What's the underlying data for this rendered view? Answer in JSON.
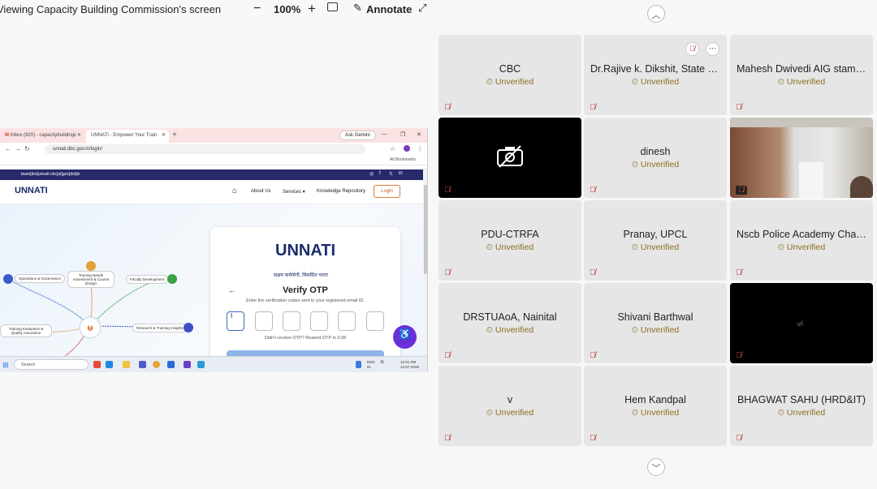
{
  "share_bar": {
    "title": "Viewing Capacity Building Commission's screen",
    "zoom_out": "−",
    "zoom": "100%",
    "zoom_in": "+",
    "annotate_icon": "pencil-icon",
    "annotate": "Annotate"
  },
  "shared_screen": {
    "tabs": [
      {
        "label": "Inbox (920) - capacitybuildingc"
      },
      {
        "label": "UNNATI - Empower Your Train"
      }
    ],
    "ask_gemini": "Ask Gemini",
    "url": "unnati.dbc.gov.in/login/",
    "bookmarks_label": "All Bookmarks",
    "site": {
      "email": "team[dot]unnati-cbc[at]gov[dot]in",
      "logo": "UNNATI",
      "nav": [
        "About Us",
        "Services ▾",
        "Knowledge Repository"
      ],
      "login": "Login",
      "nodes": [
        "Operations & Governance",
        "Training Needs Assessment & Course Design",
        "Faculty Development",
        "Training Evaluation & Quality Assurance",
        "Research & Training Insights"
      ],
      "otp": {
        "logo": "UNNATI",
        "tagline": "सक्षम कर्मयोगी, विकसित भारत",
        "title": "Verify OTP",
        "description": "Enter the verification codes sent to your registered email ID.",
        "cursor": "I",
        "resend": "Didn't receive OTP? Resend OTP  in 0:38"
      }
    },
    "taskbar": {
      "search": "Search",
      "lang": "ENG",
      "region": "IN",
      "time": "12:21 PM",
      "date": "13-07-2026"
    }
  },
  "participants": [
    {
      "name": "CBC",
      "status": "Unverified",
      "video": "off"
    },
    {
      "name": "Dr.Rajive k. Dikshit, State N...",
      "status": "Unverified",
      "video": "off",
      "hover_controls": true
    },
    {
      "name": "Mahesh Dwivedi AIG stamp...",
      "status": "Unverified",
      "video": "off"
    },
    {
      "name": "",
      "status": "",
      "video": "camera-disabled"
    },
    {
      "name": "dinesh",
      "status": "Unverified",
      "video": "off"
    },
    {
      "name": "",
      "status": "",
      "video": "on"
    },
    {
      "name": "PDU-CTRFA",
      "status": "Unverified",
      "video": "off"
    },
    {
      "name": "Pranay, UPCL",
      "status": "Unverified",
      "video": "off"
    },
    {
      "name": "Nscb Police Academy Chan...",
      "status": "Unverified",
      "video": "off"
    },
    {
      "name": "DRSTUAoA, Nainital",
      "status": "Unverified",
      "video": "off"
    },
    {
      "name": "Shivani Barthwal",
      "status": "Unverified",
      "video": "off"
    },
    {
      "name": "",
      "status": "",
      "video": "dark"
    },
    {
      "name": "v",
      "status": "Unverified",
      "video": "off"
    },
    {
      "name": "Hem Kandpal",
      "status": "Unverified",
      "video": "off"
    },
    {
      "name": "BHAGWAT SAHU (HRD&IT)",
      "status": "Unverified",
      "video": "off"
    }
  ],
  "icons": {
    "status": "clock-icon",
    "mic": "mic-off-icon",
    "page_up": "chevron-up-icon",
    "page_down": "chevron-down-icon"
  },
  "colors": {
    "status": "#8b6d1e",
    "mic_off": "#b31d1d",
    "tile_bg": "#e6e6e6"
  }
}
